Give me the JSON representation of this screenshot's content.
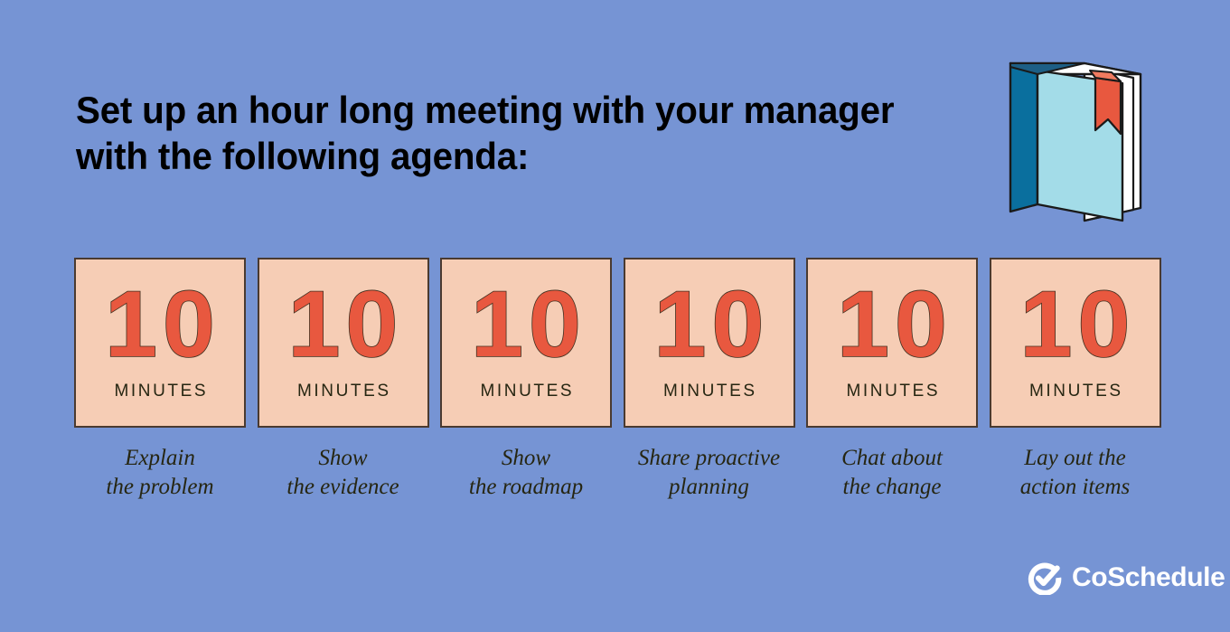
{
  "background_color": "#7694d4",
  "headline": {
    "text": "Set up an hour long meeting with your manager\nwith the following agenda:",
    "color": "#000000"
  },
  "book_icon": {
    "name": "book-icon",
    "spine_color": "#0a6f9e",
    "cover_color": "#a3dce8",
    "page_color": "#ffffff",
    "bookmark_color": "#e8583f",
    "outline_color": "#1a1a1a"
  },
  "cards": {
    "card_background": "#f6cdb5",
    "card_border_color": "#4a3a30",
    "number_color": "#e8583f",
    "number_outline_color": "#3f3020",
    "unit_color": "#262612",
    "caption_color": "#262612",
    "items": [
      {
        "number": "10",
        "unit": "MINUTES",
        "caption": "Explain\nthe problem"
      },
      {
        "number": "10",
        "unit": "MINUTES",
        "caption": "Show\nthe evidence"
      },
      {
        "number": "10",
        "unit": "MINUTES",
        "caption": "Show\nthe roadmap"
      },
      {
        "number": "10",
        "unit": "MINUTES",
        "caption": "Share proactive\nplanning"
      },
      {
        "number": "10",
        "unit": "MINUTES",
        "caption": "Chat about\nthe change"
      },
      {
        "number": "10",
        "unit": "MINUTES",
        "caption": "Lay out the\naction items"
      }
    ]
  },
  "logo": {
    "icon_name": "coschedule-check-circle-icon",
    "wordmark": "CoSchedule",
    "color": "#ffffff"
  }
}
